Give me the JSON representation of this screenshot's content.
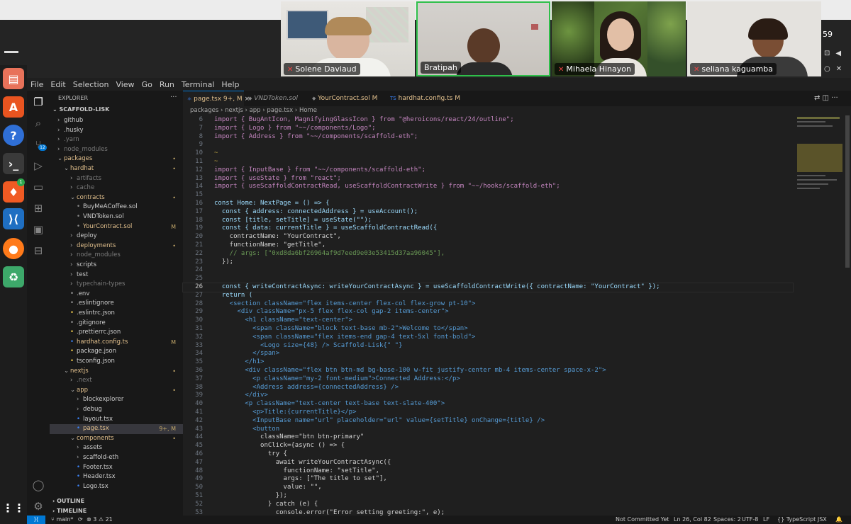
{
  "meeting": {
    "clock": "59",
    "participants": [
      {
        "name": "Solene Daviaud",
        "muted": true
      },
      {
        "name": "Bratipah",
        "muted": false
      },
      {
        "name": "Mihaela Hinayon",
        "muted": true
      },
      {
        "name": "seliana kaguamba",
        "muted": true
      }
    ]
  },
  "menu": [
    "File",
    "Edit",
    "Selection",
    "View",
    "Go",
    "Run",
    "Terminal",
    "Help"
  ],
  "explorer": {
    "title": "EXPLORER",
    "root": "SCAFFOLD-LISK",
    "items": [
      {
        "label": "github",
        "badge": ""
      },
      {
        "label": ".husky",
        "badge": ""
      },
      {
        "label": ".yarn",
        "badge": ""
      },
      {
        "label": "node_modules",
        "badge": ""
      },
      {
        "label": "packages",
        "badge": "•"
      },
      {
        "label": "hardhat",
        "badge": "•"
      },
      {
        "label": "artifacts",
        "badge": ""
      },
      {
        "label": "cache",
        "badge": ""
      },
      {
        "label": "contracts",
        "badge": "•"
      },
      {
        "label": "BuyMeACoffee.sol",
        "badge": ""
      },
      {
        "label": "VNDToken.sol",
        "badge": ""
      },
      {
        "label": "YourContract.sol",
        "badge": "M"
      },
      {
        "label": "deploy",
        "badge": ""
      },
      {
        "label": "deployments",
        "badge": "•"
      },
      {
        "label": "node_modules",
        "badge": ""
      },
      {
        "label": "scripts",
        "badge": ""
      },
      {
        "label": "test",
        "badge": ""
      },
      {
        "label": "typechain-types",
        "badge": ""
      },
      {
        "label": ".env",
        "badge": ""
      },
      {
        "label": ".eslintignore",
        "badge": ""
      },
      {
        "label": ".eslintrc.json",
        "badge": ""
      },
      {
        "label": ".gitignore",
        "badge": ""
      },
      {
        "label": ".prettierrc.json",
        "badge": ""
      },
      {
        "label": "hardhat.config.ts",
        "badge": "M"
      },
      {
        "label": "package.json",
        "badge": ""
      },
      {
        "label": "tsconfig.json",
        "badge": ""
      },
      {
        "label": "nextjs",
        "badge": "•"
      },
      {
        "label": ".next",
        "badge": ""
      },
      {
        "label": "app",
        "badge": "•"
      },
      {
        "label": "blockexplorer",
        "badge": ""
      },
      {
        "label": "debug",
        "badge": ""
      },
      {
        "label": "layout.tsx",
        "badge": ""
      },
      {
        "label": "page.tsx",
        "badge": "9+, M"
      },
      {
        "label": "components",
        "badge": "•"
      },
      {
        "label": "assets",
        "badge": ""
      },
      {
        "label": "scaffold-eth",
        "badge": ""
      },
      {
        "label": "Footer.tsx",
        "badge": ""
      },
      {
        "label": "Header.tsx",
        "badge": ""
      },
      {
        "label": "Logo.tsx",
        "badge": ""
      }
    ],
    "outline": "OUTLINE",
    "timeline": "TIMELINE"
  },
  "tabs": [
    {
      "label": "page.tsx",
      "status": "9+, M",
      "close": "×"
    },
    {
      "label": "VNDToken.sol",
      "status": "",
      "close": ""
    },
    {
      "label": "YourContract.sol",
      "status": "M",
      "close": ""
    },
    {
      "label": "hardhat.config.ts",
      "status": "M",
      "close": ""
    }
  ],
  "breadcrumb": [
    "packages",
    "nextjs",
    "app",
    "page.tsx",
    "Home"
  ],
  "code_lines": [
    {
      "n": "6",
      "text": "import { BugAntIcon, MagnifyingGlassIcon } from \"@heroicons/react/24/outline\";"
    },
    {
      "n": "7",
      "text": "import { Logo } from \"~~/components/Logo\";"
    },
    {
      "n": "8",
      "text": "import { Address } from \"~~/components/scaffold-eth\";"
    },
    {
      "n": "9",
      "text": ""
    },
    {
      "n": "10",
      "text": "~"
    },
    {
      "n": "11",
      "text": "~"
    },
    {
      "n": "12",
      "text": "import { InputBase } from \"~~/components/scaffold-eth\";"
    },
    {
      "n": "13",
      "text": "import { useState } from \"react\";"
    },
    {
      "n": "14",
      "text": "import { useScaffoldContractRead, useScaffoldContractWrite } from \"~~/hooks/scaffold-eth\";"
    },
    {
      "n": "15",
      "text": ""
    },
    {
      "n": "16",
      "text": "const Home: NextPage = () => {"
    },
    {
      "n": "17",
      "text": "  const { address: connectedAddress } = useAccount();"
    },
    {
      "n": "18",
      "text": "  const [title, setTitle] = useState(\"\");"
    },
    {
      "n": "19",
      "text": "  const { data: currentTitle } = useScaffoldContractRead({"
    },
    {
      "n": "20",
      "text": "    contractName: \"YourContract\","
    },
    {
      "n": "21",
      "text": "    functionName: \"getTitle\","
    },
    {
      "n": "22",
      "text": "    // args: [\"0xd8da6bf26964af9d7eed9e03e53415d37aa96045\"],"
    },
    {
      "n": "23",
      "text": "  });"
    },
    {
      "n": "24",
      "text": ""
    },
    {
      "n": "25",
      "text": ""
    },
    {
      "n": "26",
      "text": "  const { writeContractAsync: writeYourContractAsync } = useScaffoldContractWrite({ contractName: \"YourContract\" });"
    },
    {
      "n": "27",
      "text": "  return ("
    },
    {
      "n": "28",
      "text": "    <section className=\"flex items-center flex-col flex-grow pt-10\">"
    },
    {
      "n": "29",
      "text": "      <div className=\"px-5 flex flex-col gap-2 items-center\">"
    },
    {
      "n": "30",
      "text": "        <h1 className=\"text-center\">"
    },
    {
      "n": "31",
      "text": "          <span className=\"block text-base mb-2\">Welcome to</span>"
    },
    {
      "n": "32",
      "text": "          <span className=\"flex items-end gap-4 text-5xl font-bold\">"
    },
    {
      "n": "33",
      "text": "            <Logo size={48} /> Scaffold-Lisk{\" \"}"
    },
    {
      "n": "34",
      "text": "          </span>"
    },
    {
      "n": "35",
      "text": "        </h1>"
    },
    {
      "n": "36",
      "text": "        <div className=\"flex btn btn-md bg-base-100 w-fit justify-center mb-4 items-center space-x-2\">"
    },
    {
      "n": "37",
      "text": "          <p className=\"my-2 font-medium\">Connected Address:</p>"
    },
    {
      "n": "38",
      "text": "          <Address address={connectedAddress} />"
    },
    {
      "n": "39",
      "text": "        </div>"
    },
    {
      "n": "40",
      "text": "        <p className=\"text-center text-base text-slate-400\">"
    },
    {
      "n": "41",
      "text": "          <p>Title:{currentTitle}</p>"
    },
    {
      "n": "42",
      "text": "          <InputBase name=\"url\" placeholder=\"url\" value={setTitle} onChange={title} />"
    },
    {
      "n": "43",
      "text": "          <button"
    },
    {
      "n": "44",
      "text": "            className=\"btn btn-primary\""
    },
    {
      "n": "45",
      "text": "            onClick={async () => {"
    },
    {
      "n": "46",
      "text": "              try {"
    },
    {
      "n": "47",
      "text": "                await writeYourContractAsync({"
    },
    {
      "n": "48",
      "text": "                  functionName: \"setTitle\","
    },
    {
      "n": "49",
      "text": "                  args: [\"The title to set\"],"
    },
    {
      "n": "50",
      "text": "                  value: \"\","
    },
    {
      "n": "51",
      "text": "                });"
    },
    {
      "n": "52",
      "text": "              } catch (e) {"
    },
    {
      "n": "53",
      "text": "                console.error(\"Error setting greeting:\", e);"
    }
  ],
  "status": {
    "branch": "main*",
    "problems": "⊗ 3 ⚠ 21",
    "blame": "Not Committed Yet",
    "position": "Ln 26, Col 82",
    "spaces": "Spaces: 2",
    "encoding": "UTF-8",
    "eol": "LF",
    "language": "TypeScript JSX"
  },
  "colors": {
    "keyword": "#569cd6",
    "control": "#c586c0",
    "string": "#ce9178",
    "function": "#dcdcaa",
    "variable": "#9cdcfe",
    "type": "#4ec9b0",
    "comment": "#6a9955",
    "accent": "#0078d4"
  }
}
